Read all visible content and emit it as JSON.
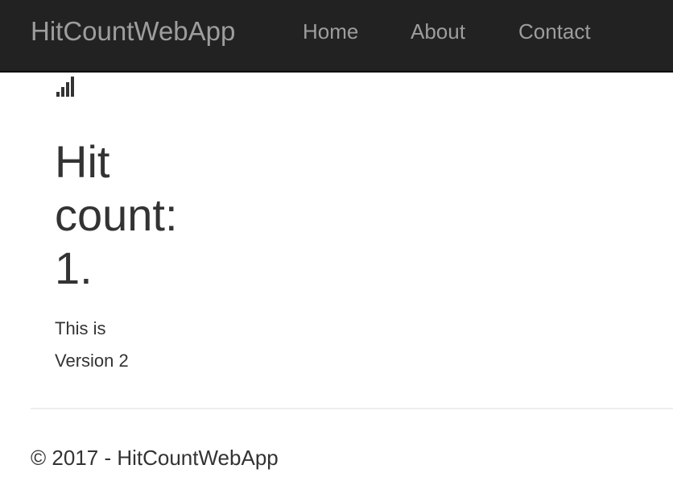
{
  "navbar": {
    "brand": "HitCountWebApp",
    "links": [
      {
        "label": "Home"
      },
      {
        "label": "About"
      },
      {
        "label": "Contact"
      }
    ]
  },
  "main": {
    "icon": "signal-bars-icon",
    "hit_count_text": "Hit count: 1.",
    "version_text": "This is Version 2"
  },
  "footer": {
    "copyright": "© 2017 - HitCountWebApp"
  },
  "colors": {
    "navbar_bg": "#222222",
    "nav_text": "#9d9d9d",
    "body_text": "#333333",
    "divider": "#eeeeee"
  }
}
